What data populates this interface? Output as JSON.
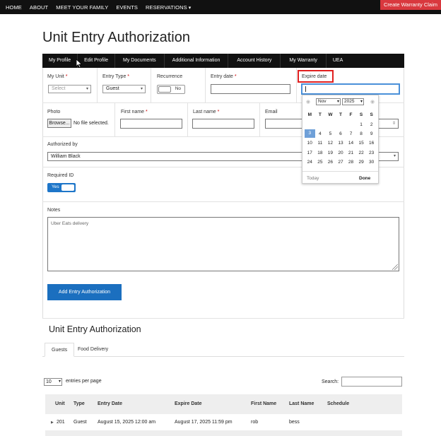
{
  "topnav": {
    "items": [
      "HOME",
      "ABOUT",
      "MEET YOUR FAMILY",
      "EVENTS",
      "RESERVATIONS"
    ],
    "warranty_button": "Create Warranty Claim"
  },
  "page_title": "Unit Entry Authorization",
  "profile_tabs": [
    "My Profile",
    "Edit Profile",
    "My Documents",
    "Additional Information",
    "Account History",
    "My Warranty",
    "UEA"
  ],
  "form": {
    "my_unit": {
      "label": "My Unit",
      "required": "*",
      "placeholder": "Select"
    },
    "entry_type": {
      "label": "Entry Type",
      "required": "*",
      "value": "Guest"
    },
    "recurrence": {
      "label": "Recurrence",
      "toggle_text": "No"
    },
    "entry_date": {
      "label": "Entry date",
      "required": "*",
      "value": ""
    },
    "expire_date": {
      "label": "Expire date",
      "value": ""
    },
    "photo": {
      "label": "Photo",
      "browse_label": "Browse...",
      "file_status": "No file selected."
    },
    "first_name": {
      "label": "First name",
      "required": "*",
      "value": ""
    },
    "last_name": {
      "label": "Last name",
      "required": "*",
      "value": ""
    },
    "email": {
      "label": "Email",
      "value": ""
    },
    "authorized_by": {
      "label": "Authorized by",
      "value": "William Black"
    },
    "required_id": {
      "label": "Required ID",
      "toggle_text": "Yes"
    },
    "notes": {
      "label": "Notes",
      "placeholder": "Uber Eats delivery"
    },
    "submit_label": "Add Entry Authorization"
  },
  "datepicker": {
    "month": "Nov",
    "year": "2025",
    "weekdays": [
      "M",
      "T",
      "W",
      "T",
      "F",
      "S",
      "S"
    ],
    "weeks": [
      [
        "",
        "",
        "",
        "",
        "",
        "1",
        "2"
      ],
      [
        "3",
        "4",
        "5",
        "6",
        "7",
        "8",
        "9"
      ],
      [
        "10",
        "11",
        "12",
        "13",
        "14",
        "15",
        "16"
      ],
      [
        "17",
        "18",
        "19",
        "20",
        "21",
        "22",
        "23"
      ],
      [
        "24",
        "25",
        "26",
        "27",
        "28",
        "29",
        "30"
      ]
    ],
    "selected_day": "3",
    "today_label": "Today",
    "done_label": "Done",
    "prev_icon": "circle-left-icon",
    "next_icon": "circle-right-icon"
  },
  "list_section": {
    "title": "Unit Entry Authorization",
    "tabs": [
      "Guests",
      "Food Delivery"
    ],
    "entries_value": "10",
    "entries_label": "entries per page",
    "search_label": "Search:",
    "columns": [
      "Unit",
      "Type",
      "Entry Date",
      "Expire Date",
      "First Name",
      "Last Name",
      "Schedule"
    ],
    "rows": [
      {
        "unit": "201",
        "type": "Guest",
        "entry_date": "August 15, 2025 12:00 am",
        "expire_date": "August 17, 2025 11:59 pm",
        "first_name": "rob",
        "last_name": "bess",
        "schedule": ""
      }
    ]
  },
  "colors": {
    "nav_bg": "#111111",
    "warranty_red": "#d9383e",
    "primary_blue": "#1b6fbf",
    "highlight_red": "#e02020",
    "selected_day": "#6fa0d8"
  }
}
